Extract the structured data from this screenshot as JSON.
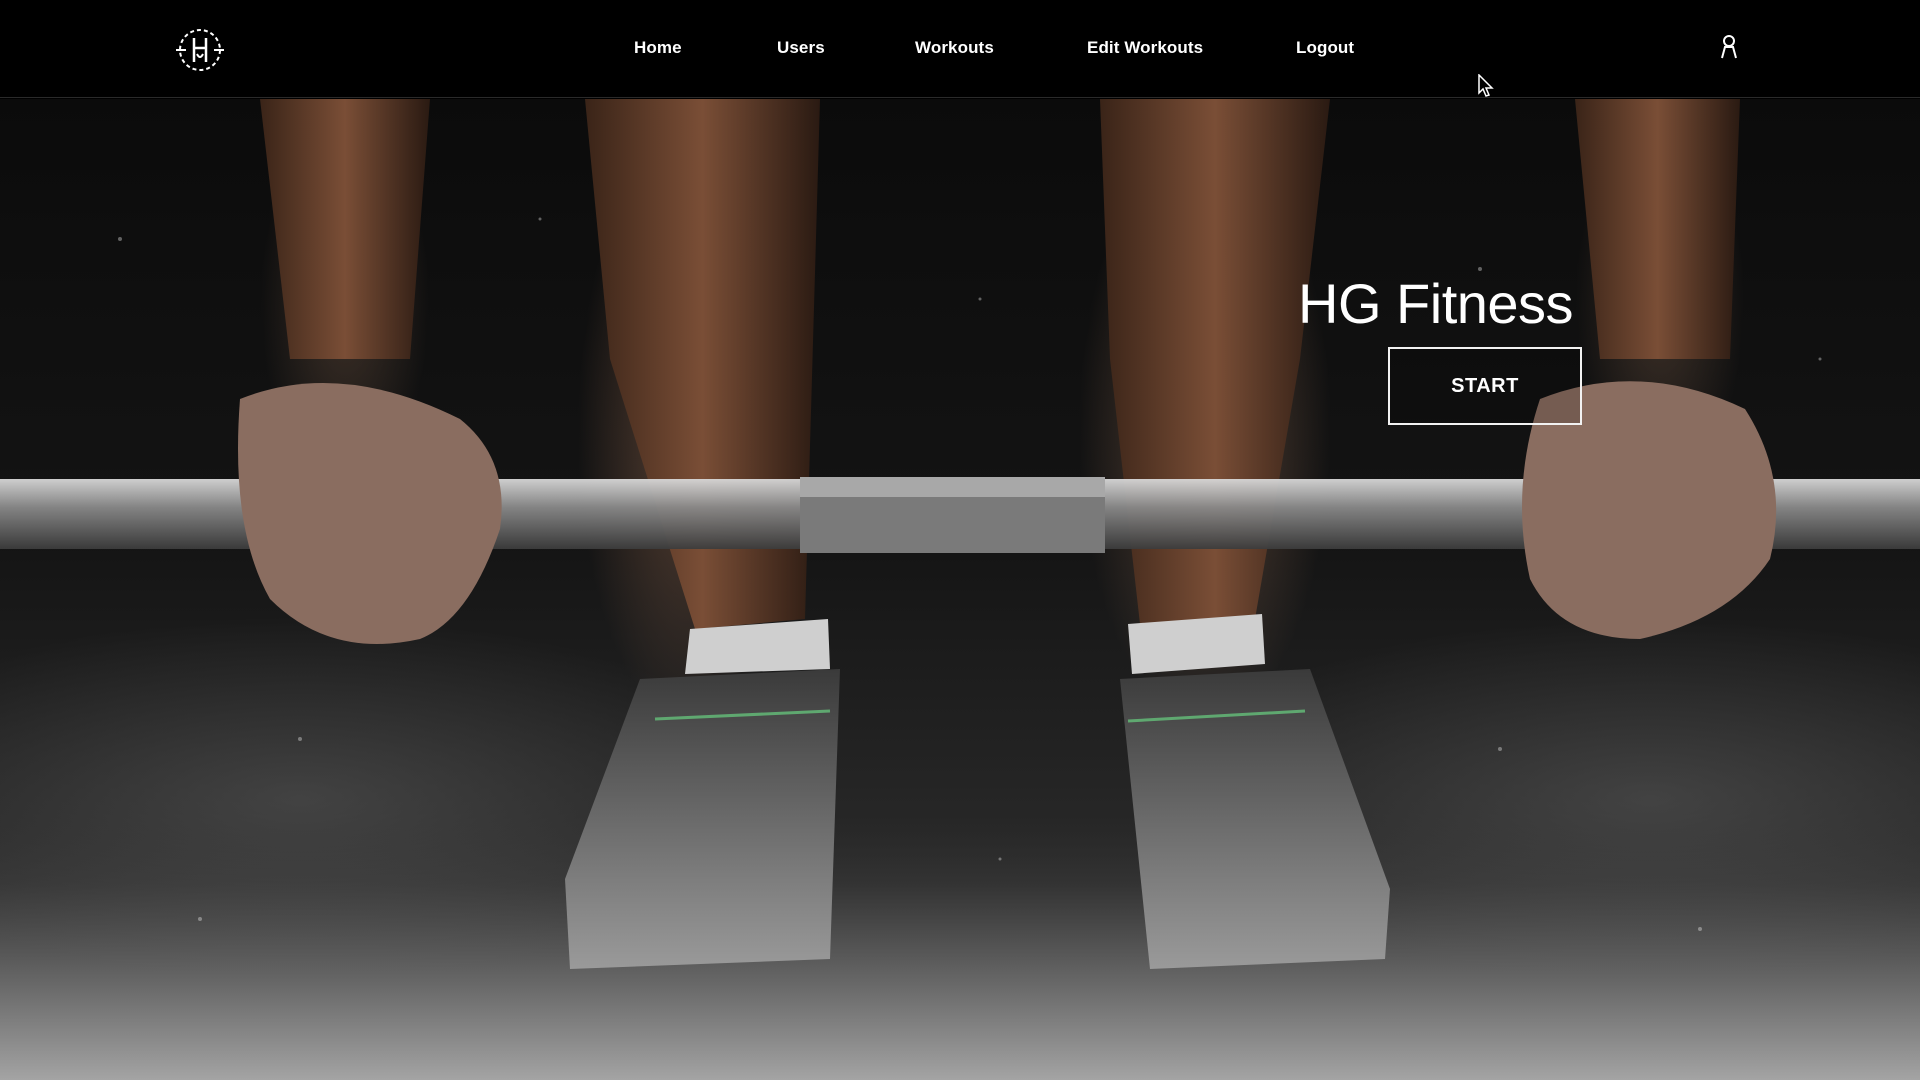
{
  "header": {
    "logo_icon": "hg-monogram-logo-icon",
    "nav": [
      {
        "label": "Home"
      },
      {
        "label": "Users"
      },
      {
        "label": "Workouts"
      },
      {
        "label": "Edit Workouts"
      },
      {
        "label": "Logout"
      }
    ],
    "account_icon": "user-icon"
  },
  "hero": {
    "title": "HG Fitness",
    "cta_label": "START",
    "image_icon": "barbell-deadlift-photo"
  },
  "colors": {
    "header_bg": "#000000",
    "text": "#ffffff"
  }
}
